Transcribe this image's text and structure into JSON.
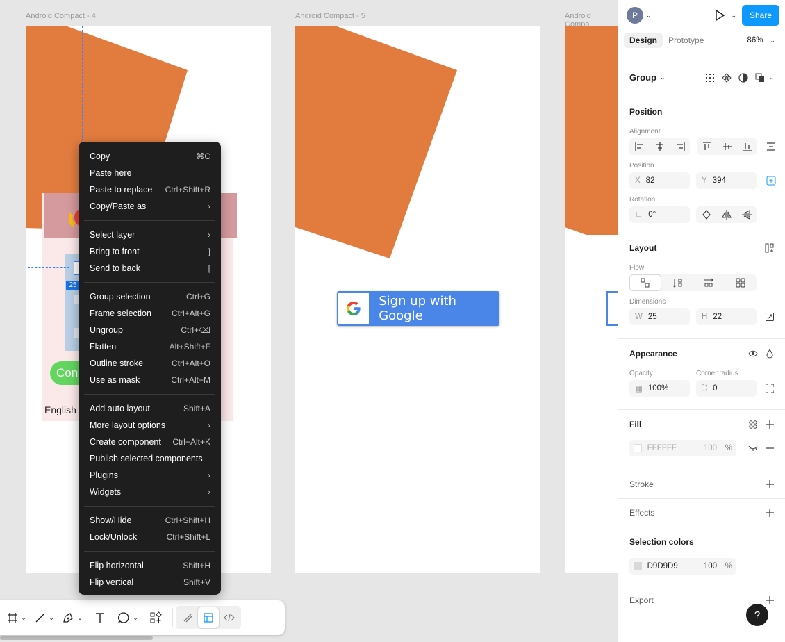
{
  "canvas": {
    "frames": [
      {
        "label": "Android Compact - 4"
      },
      {
        "label": "Android Compact - 5"
      },
      {
        "label": "Android Compa"
      }
    ],
    "google_button_text": "Sign up with Google",
    "frame4_badge": "25",
    "frame4_green_text": "Con",
    "frame4_english": "English",
    "colors": {
      "orange": "#e27c3e",
      "google_blue": "#4a86e8",
      "green": "#63d65f"
    }
  },
  "context_menu": {
    "groups": [
      [
        {
          "label": "Copy",
          "shortcut": "⌘C"
        },
        {
          "label": "Paste here",
          "shortcut": ""
        },
        {
          "label": "Paste to replace",
          "shortcut": "Ctrl+Shift+R"
        },
        {
          "label": "Copy/Paste as",
          "shortcut": "›"
        }
      ],
      [
        {
          "label": "Select layer",
          "shortcut": "›"
        },
        {
          "label": "Bring to front",
          "shortcut": "]"
        },
        {
          "label": "Send to back",
          "shortcut": "["
        }
      ],
      [
        {
          "label": "Group selection",
          "shortcut": "Ctrl+G"
        },
        {
          "label": "Frame selection",
          "shortcut": "Ctrl+Alt+G"
        },
        {
          "label": "Ungroup",
          "shortcut": "Ctrl+⌫"
        },
        {
          "label": "Flatten",
          "shortcut": "Alt+Shift+F"
        },
        {
          "label": "Outline stroke",
          "shortcut": "Ctrl+Alt+O"
        },
        {
          "label": "Use as mask",
          "shortcut": "Ctrl+Alt+M"
        }
      ],
      [
        {
          "label": "Add auto layout",
          "shortcut": "Shift+A"
        },
        {
          "label": "More layout options",
          "shortcut": "›"
        },
        {
          "label": "Create component",
          "shortcut": "Ctrl+Alt+K"
        },
        {
          "label": "Publish selected components",
          "shortcut": ""
        },
        {
          "label": "Plugins",
          "shortcut": "›"
        },
        {
          "label": "Widgets",
          "shortcut": "›"
        }
      ],
      [
        {
          "label": "Show/Hide",
          "shortcut": "Ctrl+Shift+H"
        },
        {
          "label": "Lock/Unlock",
          "shortcut": "Ctrl+Shift+L"
        }
      ],
      [
        {
          "label": "Flip horizontal",
          "shortcut": "Shift+H"
        },
        {
          "label": "Flip vertical",
          "shortcut": "Shift+V"
        }
      ]
    ]
  },
  "panel": {
    "avatar_letter": "P",
    "share_label": "Share",
    "tabs": {
      "design": "Design",
      "prototype": "Prototype"
    },
    "zoom": "86%",
    "layer_type": "Group",
    "position": {
      "title": "Position",
      "alignment_label": "Alignment",
      "position_label": "Position",
      "x_label": "X",
      "x_value": "82",
      "y_label": "Y",
      "y_value": "394",
      "rotation_label": "Rotation",
      "rotation_value": "0°"
    },
    "layout": {
      "title": "Layout",
      "flow_label": "Flow",
      "dimensions_label": "Dimensions",
      "w_label": "W",
      "w_value": "25",
      "h_label": "H",
      "h_value": "22"
    },
    "appearance": {
      "title": "Appearance",
      "opacity_label": "Opacity",
      "opacity_value": "100%",
      "radius_label": "Corner radius",
      "radius_value": "0"
    },
    "fill": {
      "title": "Fill",
      "hex": "FFFFFF",
      "opacity": "100",
      "pct": "%"
    },
    "stroke_title": "Stroke",
    "effects_title": "Effects",
    "selection_colors": {
      "title": "Selection colors",
      "hex": "D9D9D9",
      "opacity": "100",
      "pct": "%",
      "swatch": "#d9d9d9"
    },
    "export_title": "Export",
    "help": "?"
  }
}
